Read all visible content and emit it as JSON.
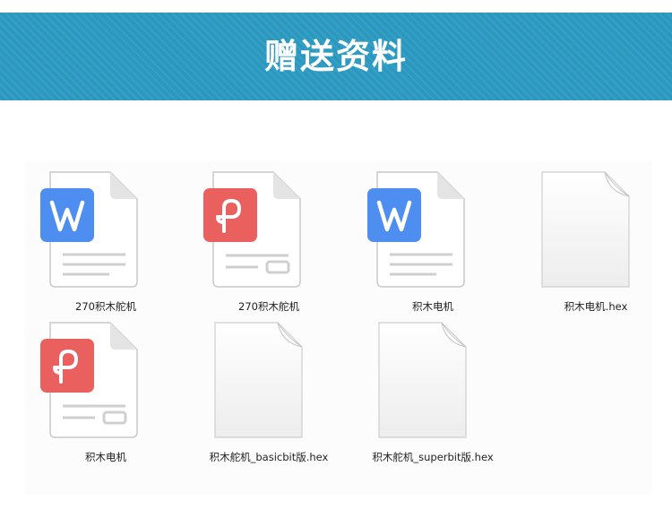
{
  "header": {
    "title": "赠送资料"
  },
  "files": [
    {
      "name": "270积木舵机",
      "icon": "wps-writer-icon",
      "badge_color": "#4e8ef0"
    },
    {
      "name": "270积木舵机",
      "icon": "wps-pdf-icon",
      "badge_color": "#e9605f"
    },
    {
      "name": "积木电机",
      "icon": "wps-writer-icon",
      "badge_color": "#4e8ef0"
    },
    {
      "name": "积木电机.hex",
      "icon": "blank-file-icon"
    },
    {
      "name": "积木电机",
      "icon": "wps-pdf-icon",
      "badge_color": "#e9605f"
    },
    {
      "name": "积木舵机_basicbit版.hex",
      "icon": "blank-file-icon"
    },
    {
      "name": "积木舵机_superbit版.hex",
      "icon": "blank-file-icon"
    }
  ]
}
